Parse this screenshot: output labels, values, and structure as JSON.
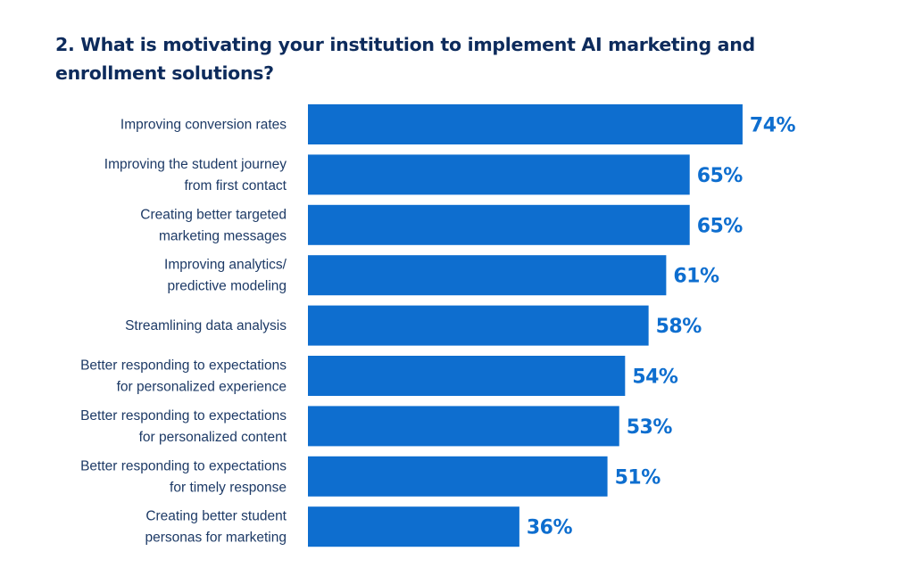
{
  "chart_data": {
    "type": "bar",
    "orientation": "horizontal",
    "title": "2. What is motivating your institution to implement AI marketing and enrollment solutions?",
    "xlabel": "",
    "ylabel": "",
    "xlim": [
      0,
      100
    ],
    "grid": false,
    "legend": "none",
    "bar_color": "#0E6ECF",
    "label_color": "#1D3A66",
    "value_color": "#0E6ECF",
    "categories": [
      [
        "Improving conversion rates"
      ],
      [
        "Improving the student journey",
        "from first contact"
      ],
      [
        "Creating better targeted",
        "marketing messages"
      ],
      [
        "Improving analytics/",
        "predictive modeling"
      ],
      [
        "Streamlining data analysis"
      ],
      [
        "Better responding to expectations",
        "for personalized experience"
      ],
      [
        "Better responding to expectations",
        "for personalized content"
      ],
      [
        "Better responding to expectations",
        "for timely response"
      ],
      [
        "Creating better student",
        "personas for marketing"
      ]
    ],
    "values": [
      74,
      65,
      65,
      61,
      58,
      54,
      53,
      51,
      36
    ],
    "value_labels": [
      "74%",
      "65%",
      "65%",
      "61%",
      "58%",
      "54%",
      "53%",
      "51%",
      "36%"
    ]
  }
}
